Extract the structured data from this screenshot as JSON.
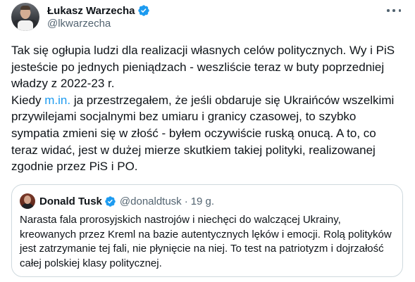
{
  "author": {
    "display_name": "Łukasz Warzecha",
    "handle": "@lkwarzecha",
    "verified_icon": "verified-badge-icon",
    "avatar": "avatar"
  },
  "menu_icon": "more-options-icon",
  "tweet": {
    "lines": [
      "Tak się ogłupia ludzi dla realizacji własnych celów politycznych. Wy i PiS",
      "jesteście po jednych pieniądzach - weszliście teraz w buty poprzedniej",
      "władzy z 2022-23 r.",
      "Kiedy ",
      " ja przestrzegałem, że jeśli obdaruje się Ukraińców wszelkimi",
      "przywilejami socjalnymi bez umiaru i granicy czasowej, to szybko",
      "sympatia zmieni się w złość - byłem oczywiście ruską onucą. A to, co",
      "teraz widać, jest w dużej mierze skutkiem takiej polityki, realizowanej",
      "zgodnie przez PiS i PO."
    ],
    "link_text": "m.in."
  },
  "quoted": {
    "display_name": "Donald Tusk",
    "handle": "@donaldtusk",
    "separator": "·",
    "time": "19 g.",
    "lines": [
      "Narasta fala prorosyjskich nastrojów i niechęci do walczącej Ukrainy,",
      "kreowanych przez Kreml na bazie autentycznych lęków i emocji. Rolą polityków",
      "jest zatrzymanie tej fali, nie płynięcie na niej. To test na patriotyzm i dojrzałość",
      "całej polskiej klasy politycznej."
    ]
  },
  "colors": {
    "link": "#1d9bf0",
    "verified": "#1d9bf0",
    "secondary_text": "#536471",
    "border": "#cfd9de"
  }
}
